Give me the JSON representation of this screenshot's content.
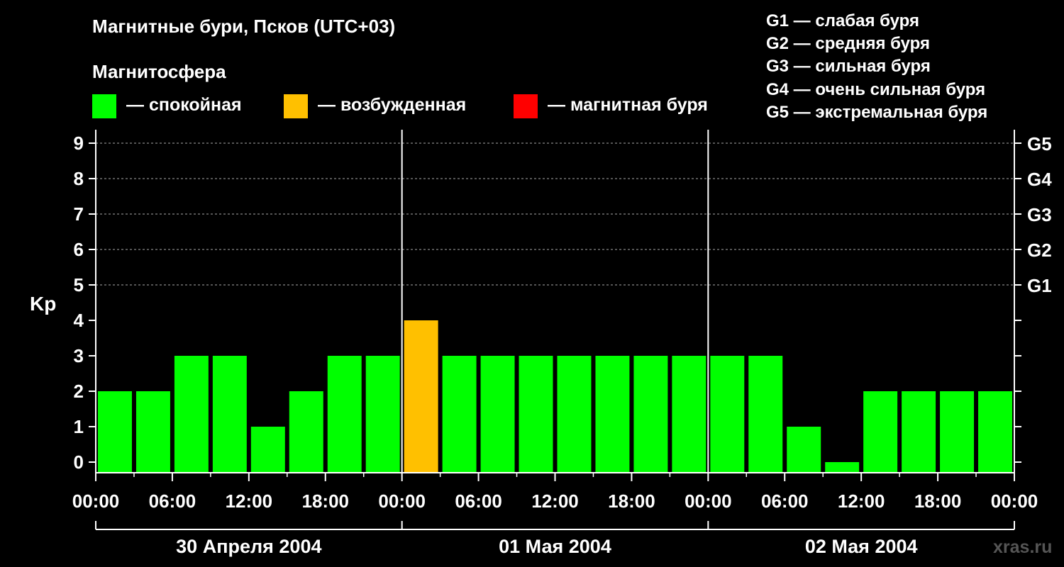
{
  "title": "Магнитные бури, Псков (UTC+03)",
  "subtitle": "Магнитосфера",
  "legend": [
    {
      "label": "— спокойная",
      "color": "#00ff00"
    },
    {
      "label": "— возбужденная",
      "color": "#ffc000"
    },
    {
      "label": "— магнитная буря",
      "color": "#ff0000"
    }
  ],
  "g_levels": [
    "G1 — слабая буря",
    "G2 — средняя буря",
    "G3 — сильная буря",
    "G4 — очень сильная буря",
    "G5 — экстремальная буря"
  ],
  "watermark": "xras.ru",
  "chart_data": {
    "type": "bar",
    "ylabel": "Kp",
    "ylim": [
      0,
      9
    ],
    "y_ticks": [
      "0",
      "1",
      "2",
      "3",
      "4",
      "5",
      "6",
      "7",
      "8",
      "9"
    ],
    "right_ticks": [
      {
        "value": 5,
        "label": "G1"
      },
      {
        "value": 6,
        "label": "G2"
      },
      {
        "value": 7,
        "label": "G3"
      },
      {
        "value": 8,
        "label": "G4"
      },
      {
        "value": 9,
        "label": "G5"
      }
    ],
    "grid": "dashed horizontal at Kp 5–9",
    "x_tick_labels": [
      "00:00",
      "06:00",
      "12:00",
      "18:00",
      "00:00",
      "06:00",
      "12:00",
      "18:00",
      "00:00",
      "06:00",
      "12:00",
      "18:00",
      "00:00"
    ],
    "days": [
      "30 Апреля 2004",
      "01 Мая 2004",
      "02 Мая 2004"
    ],
    "interval_hours": 3,
    "values": [
      2,
      2,
      3,
      3,
      1,
      2,
      3,
      3,
      4,
      3,
      3,
      3,
      3,
      3,
      3,
      3,
      3,
      3,
      1,
      0,
      2,
      2,
      2,
      2
    ],
    "colors": {
      "quiet": "#00ff00",
      "active": "#ffc000",
      "storm": "#ff0000"
    }
  }
}
